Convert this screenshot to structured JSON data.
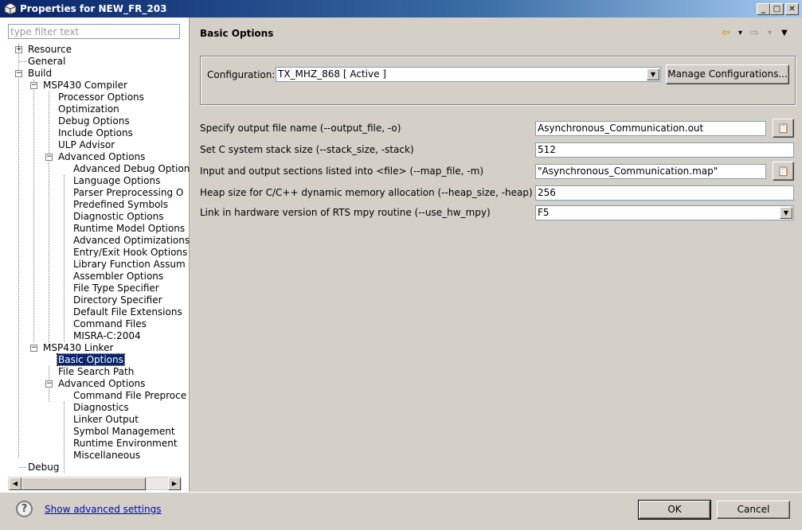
{
  "window": {
    "title": "Properties for NEW_FR_203",
    "minimize": "_",
    "maximize": "□",
    "close": "✕"
  },
  "filter": {
    "placeholder": "type filter text"
  },
  "tree": {
    "expand_plus": "+",
    "collapse_minus": "−",
    "items": [
      "Resource",
      "General",
      "Build",
      "MSP430 Compiler",
      "Processor Options",
      "Optimization",
      "Debug Options",
      "Include Options",
      "ULP Advisor",
      "Advanced Options",
      "Advanced Debug Option",
      "Language Options",
      "Parser Preprocessing O",
      "Predefined Symbols",
      "Diagnostic Options",
      "Runtime Model Options",
      "Advanced Optimizations",
      "Entry/Exit Hook Options",
      "Library Function Assum",
      "Assembler Options",
      "File Type Specifier",
      "Directory Specifier",
      "Default File Extensions",
      "Command Files",
      "MISRA-C:2004",
      "MSP430 Linker",
      "Basic Options",
      "File Search Path",
      "Advanced Options",
      "Command File Preproce",
      "Diagnostics",
      "Linker Output",
      "Symbol Management",
      "Runtime Environment",
      "Miscellaneous",
      "Debug"
    ],
    "scroll_left": "◀",
    "scroll_right": "▶"
  },
  "header": {
    "title": "Basic Options",
    "back": "⇦",
    "forward": "⇨",
    "dropdown": "▾",
    "menu": "▼"
  },
  "config": {
    "label": "Configuration:",
    "value": "TX_MHZ_868  [ Active ]",
    "manage_button": "Manage Configurations..."
  },
  "options": {
    "output_file": {
      "label": "Specify output file name (--output_file, -o)",
      "value": "Asynchronous_Communication.out"
    },
    "stack_size": {
      "label": "Set C system stack size (--stack_size, -stack)",
      "value": "512"
    },
    "map_file": {
      "label": "Input and output sections listed into <file> (--map_file, -m)",
      "value": "\"Asynchronous_Communication.map\""
    },
    "heap_size": {
      "label": "Heap size for C/C++ dynamic memory allocation (--heap_size, -heap)",
      "value": "256"
    },
    "hw_mpy": {
      "label": "Link in hardware version of RTS mpy routine (--use_hw_mpy)",
      "value": "F5"
    },
    "browse": "📋",
    "arrow": "▼"
  },
  "footer": {
    "help": "?",
    "advanced_link": "Show advanced settings",
    "ok": "OK",
    "cancel": "Cancel"
  }
}
